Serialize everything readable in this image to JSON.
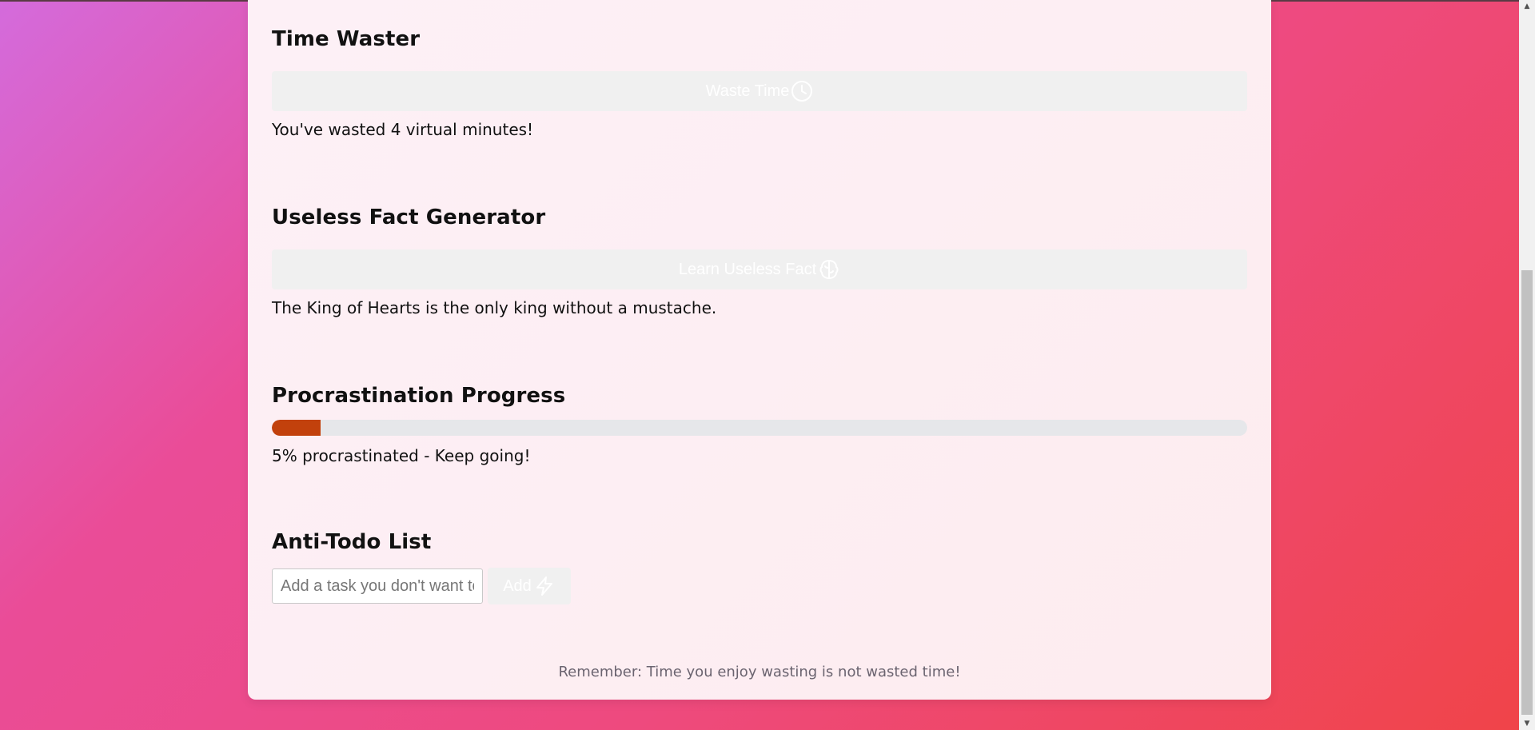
{
  "time_waster": {
    "title": "Time Waster",
    "button_label": "Waste Time",
    "button_icon": "clock-icon",
    "result": "You've wasted 4 virtual minutes!"
  },
  "useless_fact": {
    "title": "Useless Fact Generator",
    "button_label": "Learn Useless Fact",
    "button_icon": "brain-icon",
    "result": "The King of Hearts is the only king without a mustache."
  },
  "procrastination": {
    "title": "Procrastination Progress",
    "progress_percent": 5,
    "progress_color": "#c2410c",
    "status": "5% procrastinated - Keep going!"
  },
  "anti_todo": {
    "title": "Anti-Todo List",
    "input_placeholder": "Add a task you don't want to do",
    "input_value": "",
    "add_label": "Add",
    "add_icon": "lightning-icon"
  },
  "footer": {
    "text": "Remember: Time you enjoy wasting is not wasted time!"
  },
  "theme": {
    "accent": "#c2410c",
    "button_bg": "#f0f0f0"
  }
}
